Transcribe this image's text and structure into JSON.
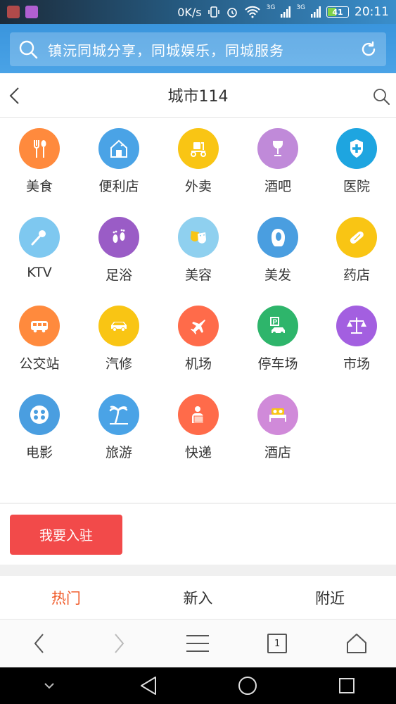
{
  "status_bar": {
    "speed": "0K/s",
    "network_1": "3G",
    "network_2": "3G",
    "battery": "41",
    "time": "20:11"
  },
  "search": {
    "placeholder": "镇沅同城分享，同城娱乐，同城服务"
  },
  "header": {
    "title": "城市114"
  },
  "categories": [
    {
      "label": "美食",
      "color": "#ff8a3d",
      "icon": "fork-spoon-icon"
    },
    {
      "label": "便利店",
      "color": "#4aa3e6",
      "icon": "store-icon"
    },
    {
      "label": "外卖",
      "color": "#f9c514",
      "icon": "scooter-icon"
    },
    {
      "label": "酒吧",
      "color": "#c08ad9",
      "icon": "wine-glass-icon"
    },
    {
      "label": "医院",
      "color": "#1ea5e0",
      "icon": "medical-cross-icon"
    },
    {
      "label": "KTV",
      "color": "#7ec8f0",
      "icon": "microphone-icon"
    },
    {
      "label": "足浴",
      "color": "#9a5cc6",
      "icon": "footprints-icon"
    },
    {
      "label": "美容",
      "color": "#8fd0ef",
      "icon": "theater-masks-icon"
    },
    {
      "label": "美发",
      "color": "#4a9ee0",
      "icon": "woman-hair-icon"
    },
    {
      "label": "药店",
      "color": "#f9c514",
      "icon": "pill-icon"
    },
    {
      "label": "公交站",
      "color": "#ff8a3d",
      "icon": "bus-icon"
    },
    {
      "label": "汽修",
      "color": "#f9c514",
      "icon": "car-icon"
    },
    {
      "label": "机场",
      "color": "#ff6b4a",
      "icon": "airplane-icon"
    },
    {
      "label": "停车场",
      "color": "#2eb56b",
      "icon": "parking-icon"
    },
    {
      "label": "市场",
      "color": "#a35fe0",
      "icon": "scales-icon"
    },
    {
      "label": "电影",
      "color": "#4a9ee0",
      "icon": "film-reel-icon"
    },
    {
      "label": "旅游",
      "color": "#4aa3e6",
      "icon": "palm-tree-icon"
    },
    {
      "label": "快递",
      "color": "#ff6b4a",
      "icon": "delivery-man-icon"
    },
    {
      "label": "酒店",
      "color": "#d08ad9",
      "icon": "hotel-bed-icon"
    }
  ],
  "join_button": "我要入驻",
  "tabs": [
    {
      "label": "热门",
      "active": true
    },
    {
      "label": "新入",
      "active": false
    },
    {
      "label": "附近",
      "active": false
    }
  ],
  "browser": {
    "tab_count": "1"
  },
  "colors": {
    "accent": "#3a95dd",
    "active_tab": "#f05a28",
    "join_button": "#f24a4a"
  }
}
